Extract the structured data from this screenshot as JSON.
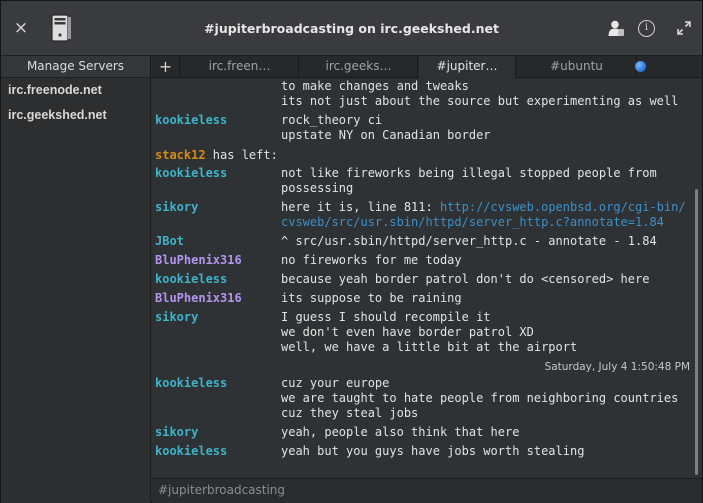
{
  "window": {
    "title": "#jupiterbroadcasting on irc.geekshed.net"
  },
  "titlebar": {
    "close_glyph": "×",
    "info_glyph": "i",
    "icons": [
      "close-icon",
      "computer-tower-icon",
      "user-icon",
      "info-icon",
      "maximize-icon"
    ]
  },
  "sidebar": {
    "header": "Manage Servers",
    "servers": [
      "irc.freenode.net",
      "irc.geekshed.net"
    ]
  },
  "tabs": {
    "add_glyph": "+",
    "items": [
      "irc.freen…",
      "irc.geeks…",
      "#jupiter…",
      "#ubuntu"
    ],
    "active_index": 2
  },
  "colors": {
    "nick_cyan": "#3eb3c9",
    "nick_orange": "#d58a13",
    "nick_purple": "#b494f0",
    "link": "#3c8fc7",
    "notification_dot": "#2f7be0"
  },
  "messages": [
    {
      "nick": "",
      "lines": [
        "to make changes and tweaks",
        "its not just about the source but experimenting as well"
      ]
    },
    {
      "nick": "kookieless",
      "color": "#3eb3c9",
      "lines": [
        "rock_theory ci",
        "upstate NY on Canadian border"
      ]
    },
    {
      "part_nick": "stack12",
      "part_text": " has left:"
    },
    {
      "nick": "kookieless",
      "color": "#3eb3c9",
      "lines": [
        "not like fireworks being illegal stopped people from",
        "possessing"
      ]
    },
    {
      "nick": "sikory",
      "color": "#3eb3c9",
      "lines": [
        "here it is, line 811: ",
        "cvsweb/src/usr.sbin/httpd/server_http.c?annotate=1.84"
      ],
      "link_start": "http://cvsweb.openbsd.org/cgi-bin/"
    },
    {
      "nick": "JBot",
      "color": "#3eb3c9",
      "lines": [
        "^ src/usr.sbin/httpd/server_http.c - annotate - 1.84"
      ]
    },
    {
      "nick": "BluPhenix316",
      "color": "#b494f0",
      "lines": [
        "no fireworks for me today"
      ]
    },
    {
      "nick": "kookieless",
      "color": "#3eb3c9",
      "lines": [
        "because yeah border patrol don't do <censored> here"
      ]
    },
    {
      "nick": "BluPhenix316",
      "color": "#b494f0",
      "lines": [
        "its suppose to be raining"
      ]
    },
    {
      "nick": "sikory",
      "color": "#3eb3c9",
      "lines": [
        "I guess I should recompile it",
        "we don't even have border patrol XD",
        "well, we have a little bit at the airport"
      ]
    },
    {
      "date": "Saturday, July  4  1:50:48 PM"
    },
    {
      "nick": "kookieless",
      "color": "#3eb3c9",
      "lines": [
        "cuz your europe",
        "we are taught to hate people from neighboring countries",
        "cuz they steal jobs"
      ]
    },
    {
      "nick": "sikory",
      "color": "#3eb3c9",
      "lines": [
        "yeah, people also think that here"
      ]
    },
    {
      "nick": "kookieless",
      "color": "#3eb3c9",
      "lines": [
        "yeah but you guys have jobs worth stealing"
      ]
    }
  ],
  "input": {
    "value": "#jupiterbroadcasting"
  }
}
